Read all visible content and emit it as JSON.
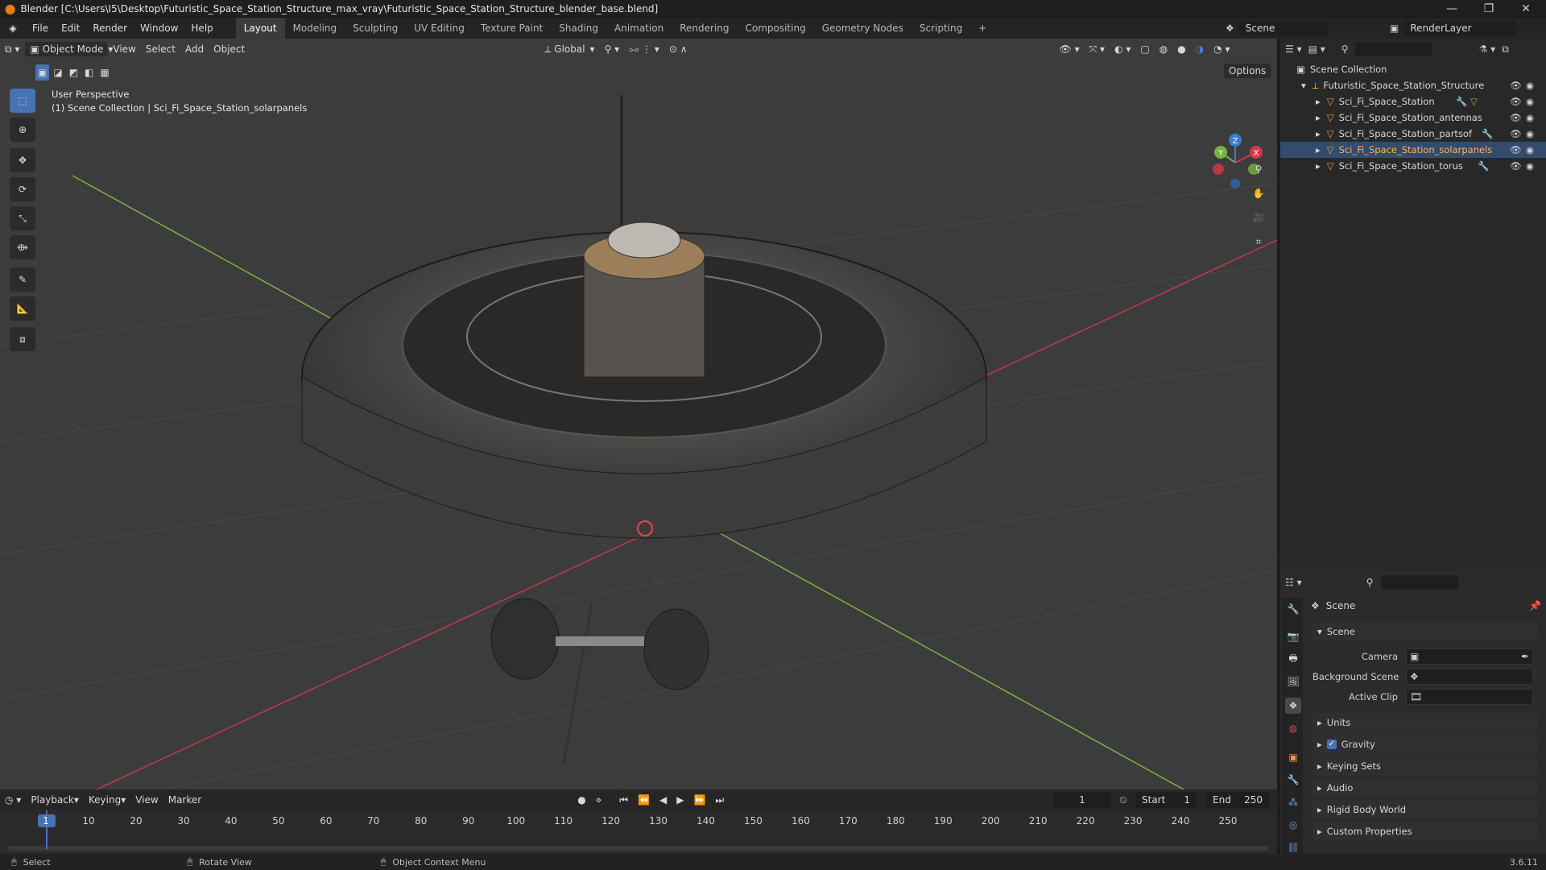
{
  "window": {
    "title": "Blender [C:\\Users\\I5\\Desktop\\Futuristic_Space_Station_Structure_max_vray\\Futuristic_Space_Station_Structure_blender_base.blend]",
    "min": "—",
    "max": "❐",
    "close": "✕"
  },
  "menus": [
    "File",
    "Edit",
    "Render",
    "Window",
    "Help"
  ],
  "workspaces": [
    "Layout",
    "Modeling",
    "Sculpting",
    "UV Editing",
    "Texture Paint",
    "Shading",
    "Animation",
    "Rendering",
    "Compositing",
    "Geometry Nodes",
    "Scripting"
  ],
  "add_workspace": "+",
  "scene": {
    "name": "Scene",
    "render_layer": "RenderLayer"
  },
  "viewport": {
    "mode": "Object Mode",
    "menu": [
      "View",
      "Select",
      "Add",
      "Object"
    ],
    "transform_orientation": "Global",
    "options": "Options",
    "perspective": "User Perspective",
    "collection_info": "(1) Scene Collection | Sci_Fi_Space_Station_solarpanels",
    "gizmo": {
      "x": "X",
      "y": "Y",
      "z": "Z"
    }
  },
  "outliner": {
    "root": "Scene Collection",
    "collection": "Futuristic_Space_Station_Structure",
    "objects": [
      "Sci_Fi_Space_Station",
      "Sci_Fi_Space_Station_antennas",
      "Sci_Fi_Space_Station_partsof",
      "Sci_Fi_Space_Station_solarpanels",
      "Sci_Fi_Space_Station_torus"
    ]
  },
  "properties": {
    "header": "Scene",
    "section_scene": "Scene",
    "camera_label": "Camera",
    "background_label": "Background Scene",
    "clip_label": "Active Clip",
    "sections": [
      "Units",
      "Gravity",
      "Keying Sets",
      "Audio",
      "Rigid Body World",
      "Custom Properties"
    ],
    "gravity_checked": true
  },
  "timeline": {
    "menus": [
      "Playback",
      "Keying",
      "View",
      "Marker"
    ],
    "current_frame": "1",
    "start_label": "Start",
    "start": "1",
    "end_label": "End",
    "end": "250",
    "ticks": [
      "1",
      "10",
      "20",
      "30",
      "40",
      "50",
      "60",
      "70",
      "80",
      "90",
      "100",
      "110",
      "120",
      "130",
      "140",
      "150",
      "160",
      "170",
      "180",
      "190",
      "200",
      "210",
      "220",
      "230",
      "240",
      "250"
    ]
  },
  "status": {
    "select": "Select",
    "rotate": "Rotate View",
    "context": "Object Context Menu",
    "version": "3.6.11"
  },
  "colors": {
    "accent": "#4772b3",
    "x_axis": "#d6394a",
    "y_axis": "#7bb343",
    "z_axis": "#3d7ad4"
  }
}
